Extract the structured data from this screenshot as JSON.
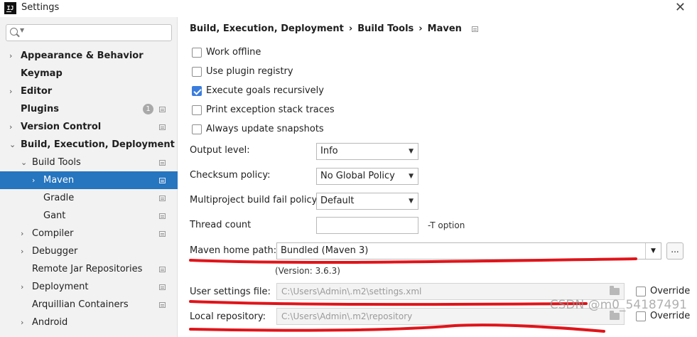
{
  "window": {
    "title": "Settings",
    "app_icon_text": "IJ"
  },
  "search": {
    "placeholder": ""
  },
  "sidebar": {
    "items": [
      {
        "label": "Appearance & Behavior",
        "bold": true,
        "has_arrow": true,
        "arrow": "›",
        "badge": "",
        "settings_icon": false
      },
      {
        "label": "Keymap",
        "bold": true,
        "has_arrow": false,
        "arrow": "",
        "badge": "",
        "settings_icon": false
      },
      {
        "label": "Editor",
        "bold": true,
        "has_arrow": true,
        "arrow": "›",
        "badge": "",
        "settings_icon": false
      },
      {
        "label": "Plugins",
        "bold": true,
        "has_arrow": false,
        "arrow": "",
        "badge": "1",
        "settings_icon": true
      },
      {
        "label": "Version Control",
        "bold": true,
        "has_arrow": true,
        "arrow": "›",
        "badge": "",
        "settings_icon": true
      },
      {
        "label": "Build, Execution, Deployment",
        "bold": true,
        "has_arrow": true,
        "arrow": "⌄",
        "badge": "",
        "settings_icon": false
      },
      {
        "label": "Build Tools",
        "bold": false,
        "has_arrow": true,
        "arrow": "⌄",
        "badge": "",
        "settings_icon": true
      },
      {
        "label": "Maven",
        "bold": false,
        "has_arrow": true,
        "arrow": "›",
        "badge": "",
        "settings_icon": true,
        "selected": true
      },
      {
        "label": "Gradle",
        "bold": false,
        "has_arrow": false,
        "arrow": "",
        "badge": "",
        "settings_icon": true
      },
      {
        "label": "Gant",
        "bold": false,
        "has_arrow": false,
        "arrow": "",
        "badge": "",
        "settings_icon": true
      },
      {
        "label": "Compiler",
        "bold": false,
        "has_arrow": true,
        "arrow": "›",
        "badge": "",
        "settings_icon": true
      },
      {
        "label": "Debugger",
        "bold": false,
        "has_arrow": true,
        "arrow": "›",
        "badge": "",
        "settings_icon": false
      },
      {
        "label": "Remote Jar Repositories",
        "bold": false,
        "has_arrow": false,
        "arrow": "",
        "badge": "",
        "settings_icon": true
      },
      {
        "label": "Deployment",
        "bold": false,
        "has_arrow": true,
        "arrow": "›",
        "badge": "",
        "settings_icon": true
      },
      {
        "label": "Arquillian Containers",
        "bold": false,
        "has_arrow": false,
        "arrow": "",
        "badge": "",
        "settings_icon": true
      },
      {
        "label": "Android",
        "bold": false,
        "has_arrow": true,
        "arrow": "›",
        "badge": "",
        "settings_icon": false
      }
    ]
  },
  "breadcrumb": {
    "part1": "Build, Execution, Deployment",
    "part2": "Build Tools",
    "part3": "Maven",
    "separator": "›"
  },
  "checkboxes": [
    {
      "label": "Work offline",
      "checked": false
    },
    {
      "label": "Use plugin registry",
      "checked": false
    },
    {
      "label": "Execute goals recursively",
      "checked": true
    },
    {
      "label": "Print exception stack traces",
      "checked": false
    },
    {
      "label": "Always update snapshots",
      "checked": false
    }
  ],
  "form": {
    "output_level": {
      "label": "Output level:",
      "value": "Info"
    },
    "checksum_policy": {
      "label": "Checksum policy:",
      "value": "No Global Policy"
    },
    "multiproject_fail": {
      "label": "Multiproject build fail policy:",
      "value": "Default"
    },
    "thread_count": {
      "label": "Thread count",
      "value": "",
      "hint": "-T option"
    },
    "maven_home": {
      "label": "Maven home path:",
      "value": "Bundled (Maven 3)",
      "version": "(Version: 3.6.3)",
      "browse_label": "..."
    },
    "user_settings": {
      "label": "User settings file:",
      "value": "C:\\Users\\Admin\\.m2\\settings.xml",
      "override_label": "Override",
      "override_checked": false
    },
    "local_repo": {
      "label": "Local repository:",
      "value": "C:\\Users\\Admin\\.m2\\repository",
      "override_label": "Override",
      "override_checked": false
    }
  },
  "icons": {
    "dropdown": "▼",
    "close": "✕"
  },
  "watermark": "CSDN @m0_54187491",
  "colors": {
    "selection": "#2675bf",
    "checkbox_checked": "#3b7ddd",
    "annotation_red": "#e0141a",
    "sidebar_bg": "#f2f2f2"
  }
}
